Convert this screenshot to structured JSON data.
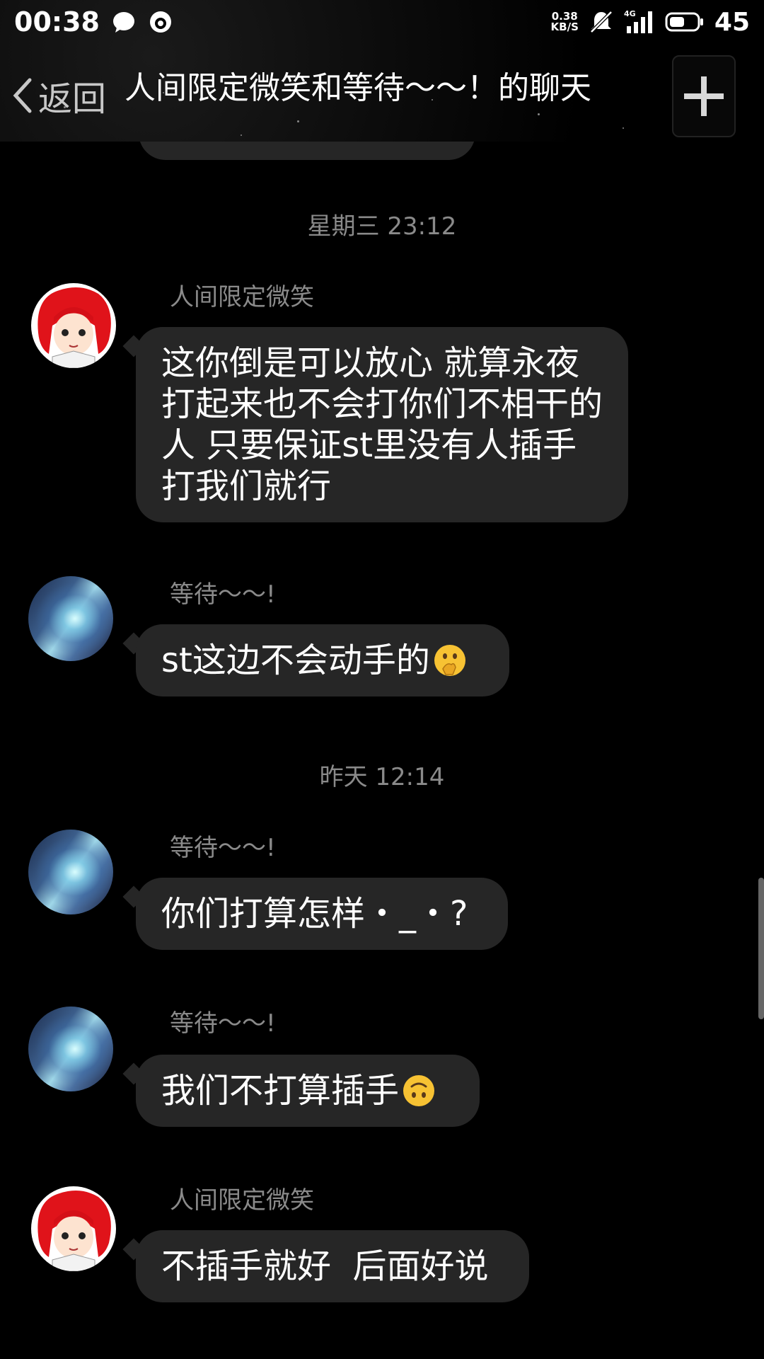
{
  "status_bar": {
    "time": "00:38",
    "speed_value": "0.38",
    "speed_unit": "KB/S",
    "network": "4G",
    "battery": "45"
  },
  "header": {
    "back_label": "返回",
    "title": "人间限定微笑和等待～～！的聊天"
  },
  "messages": [
    {
      "type": "timestamp",
      "text": "星期三 23:12"
    },
    {
      "type": "message",
      "sender": "人间限定微笑",
      "text": "这你倒是可以放心 就算永夜打起来也不会打你们不相干的人 只要保证st里没有人插手打我们就行"
    },
    {
      "type": "message",
      "sender": "等待～～!",
      "text": "st这边不会动手的"
    },
    {
      "type": "timestamp",
      "text": "昨天 12:14"
    },
    {
      "type": "message",
      "sender": "等待～～!",
      "text": "你们打算怎样・_・?"
    },
    {
      "type": "message",
      "sender": "等待～～!",
      "text": "我们不打算插手"
    },
    {
      "type": "message",
      "sender": "人间限定微笑",
      "text": "不插手就好  后面好说"
    }
  ],
  "icons": {
    "back": "chevron-left-icon",
    "add": "plus-icon",
    "shushing_emoji": "shushing-face-emoji",
    "upside_down_emoji": "upside-down-face-emoji"
  },
  "colors": {
    "background": "#000000",
    "bubble": "#262626",
    "meta_text": "#8a8a8a",
    "text": "#ffffff"
  }
}
